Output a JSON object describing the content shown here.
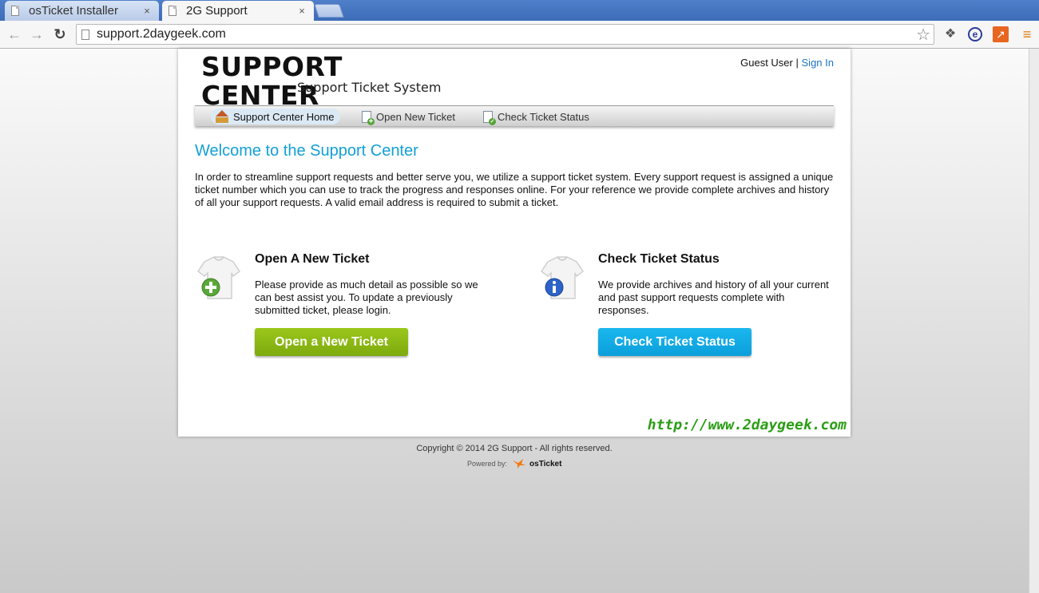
{
  "browser": {
    "tabs": [
      {
        "title": "osTicket Installer",
        "close": "×"
      },
      {
        "title": "2G Support",
        "close": "×"
      }
    ],
    "url": "support.2daygeek.com",
    "icons": [
      "back-arrow-icon",
      "forward-arrow-icon",
      "reload-icon",
      "page-icon",
      "star-icon",
      "puzzle-icon",
      "e-extension-icon",
      "chart-extension-icon",
      "menu-icon"
    ]
  },
  "header": {
    "logo_title": "SUPPORT CENTER",
    "logo_subtitle": "Support Ticket System",
    "guest_label": "Guest User",
    "separator": "|",
    "sign_in": "Sign In"
  },
  "nav": {
    "items": [
      {
        "label": "Support Center Home",
        "icon": "home-icon",
        "active": true
      },
      {
        "label": "Open New Ticket",
        "icon": "new-ticket-icon"
      },
      {
        "label": "Check Ticket Status",
        "icon": "ticket-status-icon"
      }
    ]
  },
  "main": {
    "welcome_title": "Welcome to the Support Center",
    "intro": "In order to streamline support requests and better serve you, we utilize a support ticket system. Every support request is assigned a unique ticket number which you can use to track the progress and responses online. For your reference we provide complete archives and history of all your support requests. A valid email address is required to submit a ticket.",
    "open_card": {
      "title": "Open A New Ticket",
      "text": "Please provide as much detail as possible so we can best assist you. To update a previously submitted ticket, please login.",
      "button": "Open a New Ticket"
    },
    "status_card": {
      "title": "Check Ticket Status",
      "text": "We provide archives and history of all your current and past support requests complete with responses.",
      "button": "Check Ticket Status"
    },
    "watermark": "http://www.2daygeek.com"
  },
  "footer": {
    "copyright": "Copyright © 2014 2G Support - All rights reserved.",
    "powered_by": "Powered by:",
    "brand": "osTicket"
  },
  "colors": {
    "accent": "#12a0d8",
    "green_button": "#8cbb14",
    "blue_button": "#10aae5",
    "link": "#1b74c5"
  }
}
